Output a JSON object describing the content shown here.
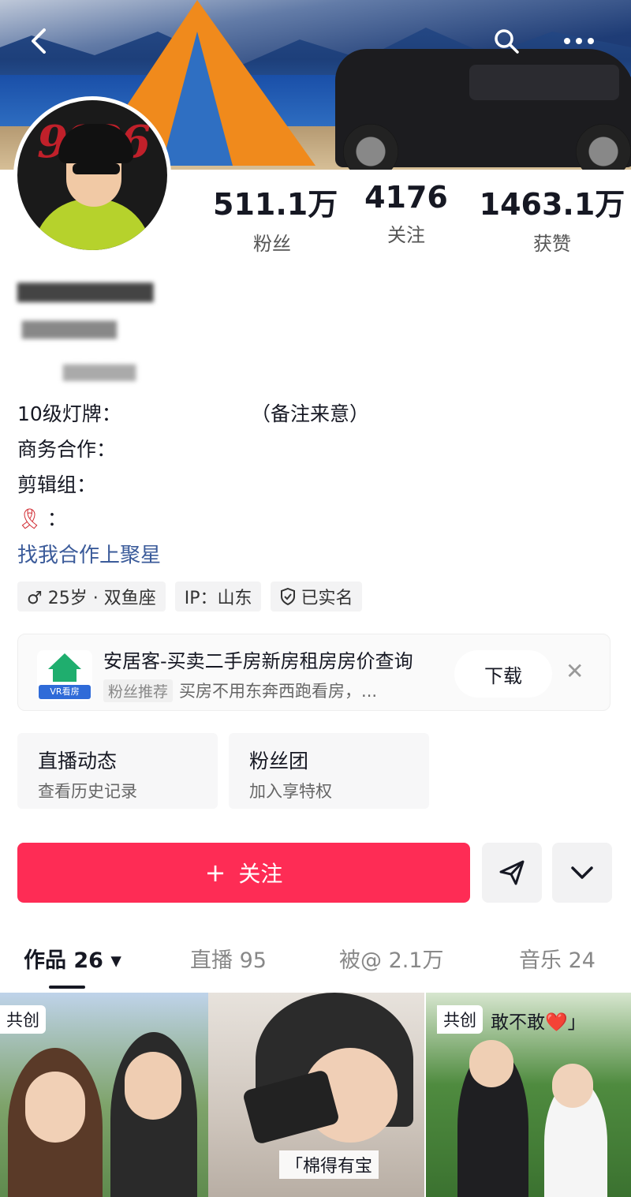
{
  "header": {
    "back_icon": "chevron-left-icon",
    "search_icon": "search-icon",
    "more_icon": "more-dots-icon",
    "avatar_text": "9026"
  },
  "stats": [
    {
      "value": "511.1万",
      "label": "粉丝"
    },
    {
      "value": "4176",
      "label": "关注"
    },
    {
      "value": "1463.1万",
      "label": "获赞"
    }
  ],
  "bio": {
    "line1_label": "10级灯牌：",
    "line1_note": "（备注来意）",
    "line2_label": "商务合作：",
    "line3_label": "剪辑组：",
    "line4_label": "：",
    "coop_link": "找我合作上聚星"
  },
  "tags": [
    {
      "text": "♂ 25岁 · 双鱼座"
    },
    {
      "text": "IP：山东"
    },
    {
      "text": "已实名"
    }
  ],
  "ad": {
    "title": "安居客-买卖二手房新房租房房价查询",
    "badge": "粉丝推荐",
    "subtitle": "买房不用东奔西跑看房，...",
    "logo_tag": "VR看房",
    "download_label": "下载",
    "close_symbol": "✕"
  },
  "entries": [
    {
      "title": "直播动态",
      "subtitle": "查看历史记录"
    },
    {
      "title": "粉丝团",
      "subtitle": "加入享特权"
    }
  ],
  "actions": {
    "follow_plus": "+",
    "follow_label": "关注",
    "share_symbol": "➤",
    "expand_symbol": "⌄"
  },
  "tabs": [
    {
      "label": "作品 26 ▾",
      "active": true
    },
    {
      "label": "直播 95",
      "active": false
    },
    {
      "label": "被@ 2.1万",
      "active": false
    },
    {
      "label": "音乐 24",
      "active": false
    }
  ],
  "thumbnails": [
    {
      "badge": "共创"
    },
    {
      "caption": "「棉得有宝"
    },
    {
      "badge": "共创",
      "topline": "敢不敢",
      "heart": "❤️",
      "end": "」"
    }
  ],
  "colors": {
    "primary": "#fe2c55",
    "link": "#3b5b9a",
    "text": "#161823"
  }
}
